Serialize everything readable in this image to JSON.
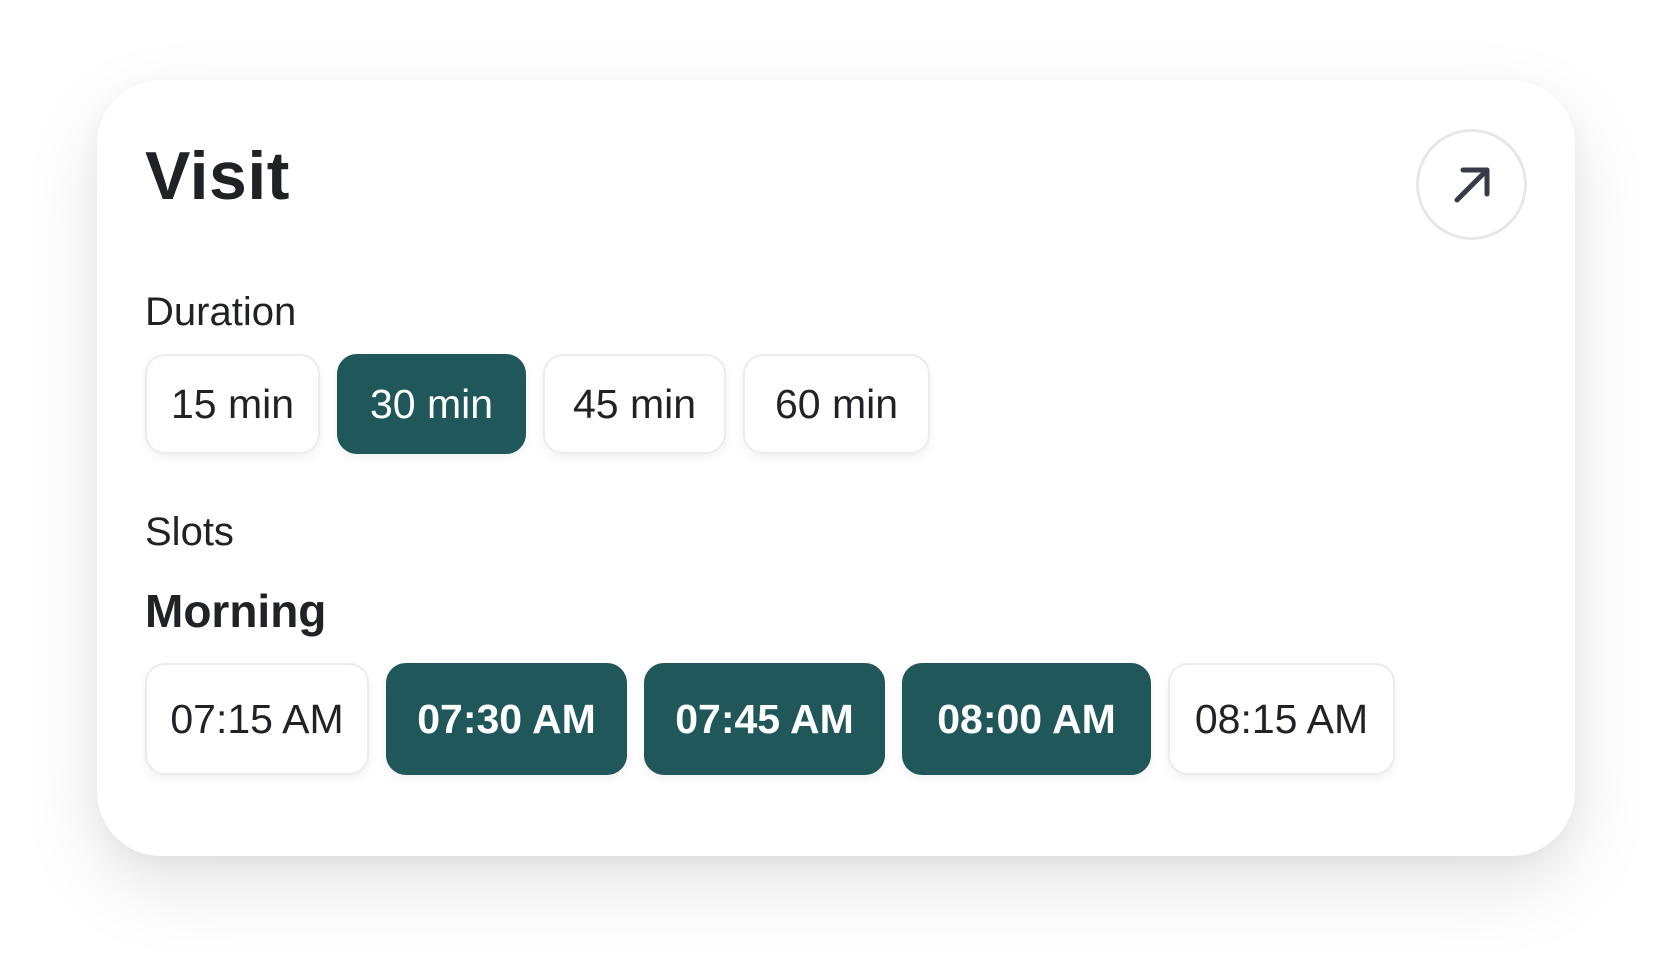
{
  "card": {
    "title": "Visit",
    "open_icon": "arrow-up-right-icon"
  },
  "duration": {
    "label": "Duration",
    "options": [
      {
        "label": "15 min",
        "selected": false
      },
      {
        "label": "30 min",
        "selected": true
      },
      {
        "label": "45 min",
        "selected": false
      },
      {
        "label": "60 min",
        "selected": false
      }
    ]
  },
  "slots": {
    "label": "Slots",
    "groups": [
      {
        "title": "Morning",
        "options": [
          {
            "label": "07:15 AM",
            "selected": false
          },
          {
            "label": "07:30 AM",
            "selected": true
          },
          {
            "label": "07:45 AM",
            "selected": true
          },
          {
            "label": "08:00 AM",
            "selected": true
          },
          {
            "label": "08:15 AM",
            "selected": false
          }
        ]
      }
    ]
  },
  "colors": {
    "accent": "#1f575b",
    "text": "#202226",
    "chip_border": "#ebecee"
  }
}
